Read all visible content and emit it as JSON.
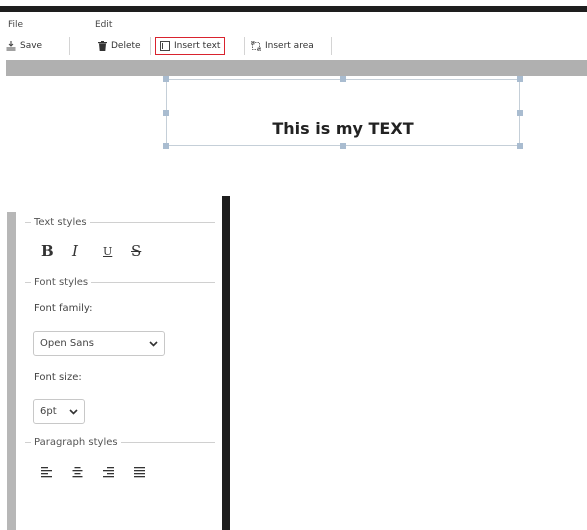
{
  "menu": {
    "file": "File",
    "edit": "Edit"
  },
  "toolbar": {
    "save": "Save",
    "delete": "Delete",
    "insert_text": "Insert text",
    "insert_area": "Insert area"
  },
  "canvas": {
    "text": "This is my TEXT"
  },
  "panel": {
    "text_styles": {
      "title": "Text styles",
      "bold": "B",
      "italic": "I",
      "underline": "U",
      "strikethrough": "S"
    },
    "font_styles": {
      "title": "Font styles",
      "family_label": "Font family:",
      "family_value": "Open Sans",
      "size_label": "Font size:",
      "size_value": "6pt"
    },
    "paragraph_styles": {
      "title": "Paragraph styles"
    }
  },
  "colors": {
    "highlight_border": "#d9232e",
    "handle": "#a9bcd0"
  },
  "icons": {
    "save": "save-icon",
    "delete": "trash-icon",
    "insert_text": "text-frame-icon",
    "insert_area": "area-frame-icon",
    "align": [
      "align-left-icon",
      "align-center-icon",
      "align-right-icon",
      "align-justify-icon"
    ]
  }
}
